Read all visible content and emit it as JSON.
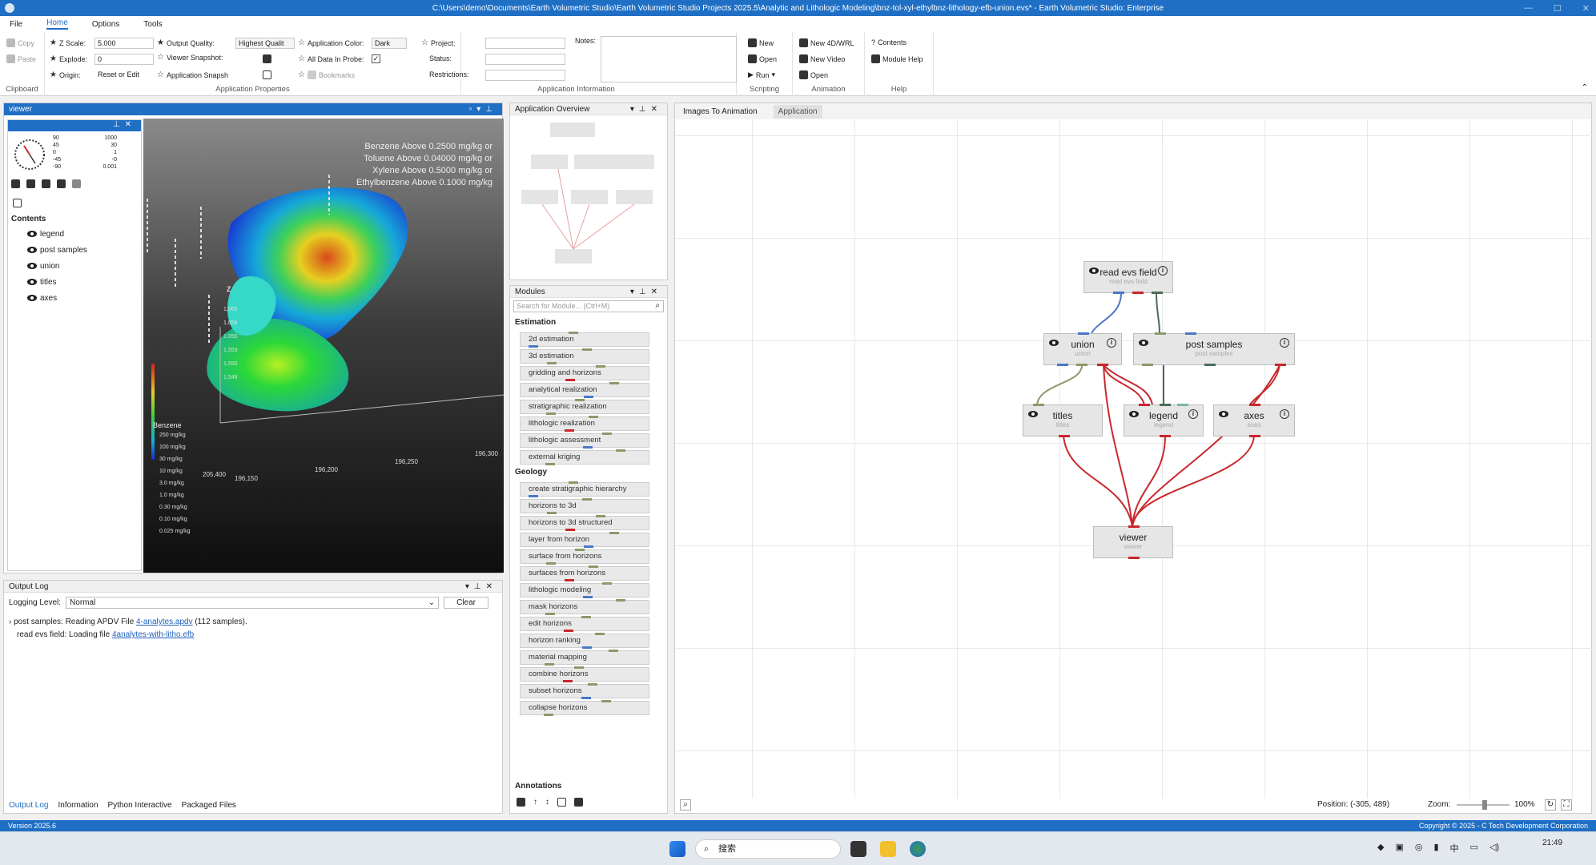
{
  "window": {
    "title": "C:\\Users\\demo\\Documents\\Earth Volumetric Studio\\Earth Volumetric Studio Projects 2025.5\\Analytic and Lithologic Modeling\\bnz-tol-xyl-ethylbnz-lithology-efb-union.evs* - Earth Volumetric Studio: Enterprise"
  },
  "menu": [
    "File",
    "Home",
    "Options",
    "Tools"
  ],
  "ribbon": {
    "clipboard": {
      "copy": "Copy",
      "paste": "Paste",
      "label": "Clipboard"
    },
    "props": {
      "zscale_label": "Z Scale:",
      "zscale_value": "5.000",
      "explode_label": "Explode:",
      "explode_value": "0",
      "origin_label": "Origin:",
      "origin_value": "Reset or Edit",
      "quality_label": "Output Quality:",
      "quality_value": "Highest Qualit",
      "snapshot_label": "Viewer Snapshot:",
      "appsnap_label": "Application Snapsh",
      "color_label": "Application Color:",
      "color_value": "Dark",
      "probe_label": "All Data In Probe:",
      "bookmarks_label": "Bookmarks",
      "label": "Application Properties"
    },
    "info": {
      "project": "Project:",
      "status": "Status:",
      "restrictions": "Restrictions:",
      "notes": "Notes:",
      "label": "Application Information"
    },
    "scripting": {
      "new": "New",
      "open": "Open",
      "run": "Run",
      "label": "Scripting"
    },
    "animation": {
      "new4d": "New 4D/WRL",
      "newvideo": "New Video",
      "open": "Open",
      "label": "Animation"
    },
    "help": {
      "contents": "Contents",
      "modhelp": "Module Help",
      "label": "Help"
    }
  },
  "viewer": {
    "title": "viewer",
    "contents_label": "Contents",
    "items": [
      "legend",
      "post samples",
      "union",
      "titles",
      "axes"
    ],
    "compass": [
      "90",
      "1000",
      "45",
      "30",
      "0",
      "1",
      "-45",
      "-0",
      "-90",
      "0.001"
    ],
    "overlay": [
      "Benzene Above 0.2500 mg/kg or",
      "Toluene Above 0.04000 mg/kg or",
      "Xylene Above 0.5000 mg/kg or",
      "Ethylbenzene Above 0.1000 mg/kg"
    ],
    "legend_title": "Benzene",
    "legend_labels": [
      "250 mg/kg",
      "100 mg/kg",
      "30 mg/kg",
      "10 mg/kg",
      "3.0 mg/kg",
      "1.0 mg/kg",
      "0.30 mg/kg",
      "0.10 mg/kg",
      "0.025 mg/kg"
    ],
    "axis_x": [
      "196,150",
      "196,200",
      "196,250",
      "196,300"
    ],
    "axis_y": [
      "205,400"
    ],
    "axis_z": [
      "1,060",
      "1,058",
      "1,055",
      "1,553",
      "1,550",
      "1,548"
    ],
    "z_label": "Z"
  },
  "overview": {
    "title": "Application Overview"
  },
  "modules": {
    "title": "Modules",
    "search_placeholder": "Search for Module... (Ctrl+M)",
    "categories": [
      {
        "name": "Estimation",
        "items": [
          "2d estimation",
          "3d estimation",
          "gridding and horizons",
          "analytical realization",
          "stratigraphic realization",
          "lithologic realization",
          "lithologic assessment",
          "external kriging"
        ]
      },
      {
        "name": "Geology",
        "items": [
          "create stratigraphic hierarchy",
          "horizons to 3d",
          "horizons to 3d structured",
          "layer from horizon",
          "surface from horizons",
          "surfaces from horizons",
          "lithologic modeling",
          "mask horizons",
          "edit horizons",
          "horizon ranking",
          "material mapping",
          "combine horizons",
          "subset horizons",
          "collapse horizons"
        ]
      }
    ],
    "annotations_label": "Annotations"
  },
  "output": {
    "title": "Output Log",
    "level_label": "Logging Level:",
    "level_value": "Normal",
    "clear": "Clear",
    "lines": [
      {
        "text": "post samples: Reading APDV File ",
        "link": "4-analytes.apdv",
        "tail": " (112 samples)."
      },
      {
        "text": "read evs field: Loading file ",
        "link": "4analytes-with-litho.efb",
        "tail": ""
      }
    ],
    "tabs": [
      "Output Log",
      "Information",
      "Python Interactive",
      "Packaged Files"
    ]
  },
  "canvas": {
    "tabs": [
      "Images To Animation",
      "Application"
    ],
    "nodes": {
      "read": {
        "title": "read evs field",
        "sub": "read evs field"
      },
      "union": {
        "title": "union",
        "sub": "union"
      },
      "post": {
        "title": "post samples",
        "sub": "post samples"
      },
      "titles": {
        "title": "titles",
        "sub": "titles"
      },
      "legend": {
        "title": "legend",
        "sub": "legend"
      },
      "axes": {
        "title": "axes",
        "sub": "axes"
      },
      "viewer": {
        "title": "viewer",
        "sub": "viewer"
      }
    },
    "position": "Position: (-305, 489)",
    "zoom_label": "Zoom:",
    "zoom_value": "100%"
  },
  "status": {
    "version": "Version 2025.6",
    "copyright": "Copyright © 2025 - C Tech Development Corporation"
  },
  "taskbar": {
    "search": "搜索",
    "time": "21:49"
  },
  "colors": {
    "accent": "#1f6fc5",
    "link_red": "#c8282d",
    "link_blue": "#4a78c8"
  }
}
